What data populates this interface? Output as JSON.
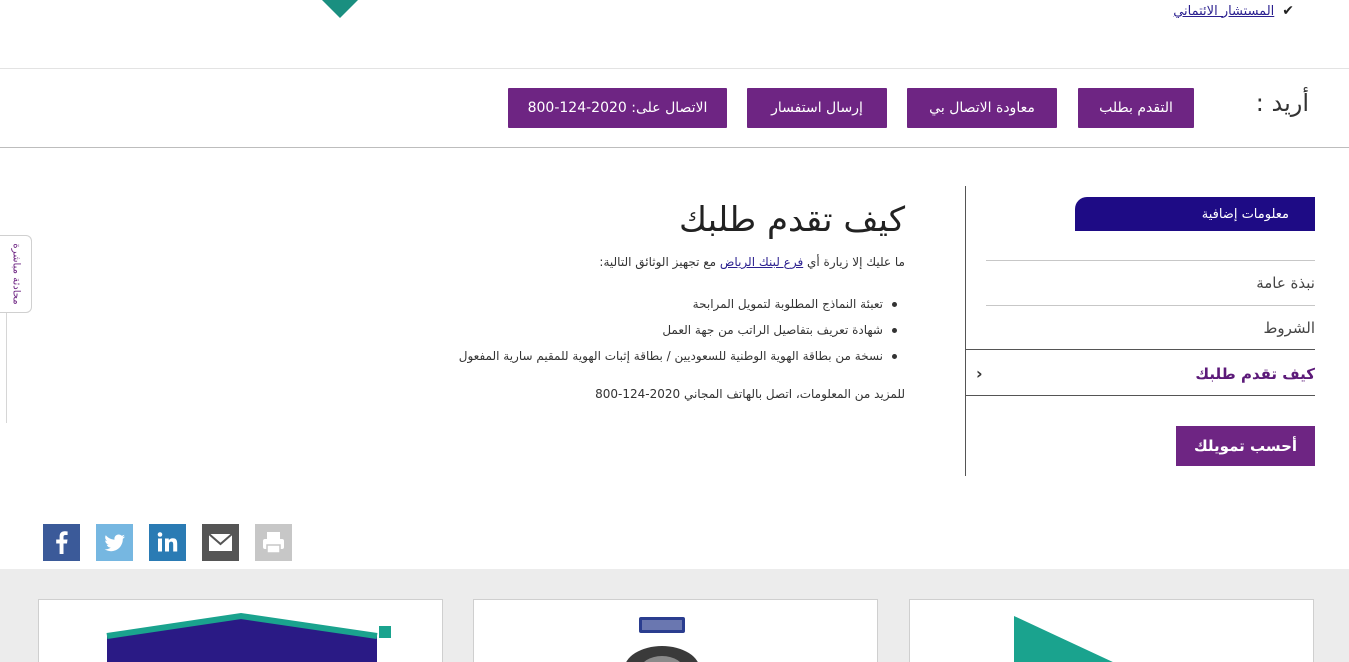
{
  "top": {
    "link_label": "المستشار الائتماني",
    "check_icon": "check-icon",
    "logo_icon": "brand-logo-icon"
  },
  "action_bar": {
    "want_label": "أريد :",
    "buttons": [
      {
        "label": "التقدم بطلب"
      },
      {
        "label": "معاودة الاتصال بي"
      },
      {
        "label": "إرسال استفسار"
      },
      {
        "label": "الاتصال على: 2020-124-800"
      }
    ]
  },
  "side_tab": {
    "label": "محادثة مباشرة"
  },
  "main": {
    "title": "كيف تقدم طلبك",
    "intro_before": "ما عليك إلا زيارة أي ",
    "intro_link": "فرع لبنك الرياض",
    "intro_after": " مع تجهيز الوثائق التالية:",
    "documents": [
      "تعبئة النماذج المطلوبة لتمويل المرابحة",
      "شهادة تعريف بتفاصيل الراتب من جهة العمل",
      "نسخة من بطاقة الهوية الوطنية للسعوديين / بطاقة إثبات الهوية للمقيم سارية المفعول"
    ],
    "more_info": "للمزيد من المعلومات، اتصل بالهاتف المجاني 2020-124-800"
  },
  "panel": {
    "header": "معلومات إضافية",
    "items": [
      {
        "label": "نبذة عامة"
      },
      {
        "label": "الشروط"
      }
    ],
    "active_item": "كيف تقدم طلبك",
    "calculator_button": "أحسب تمويلك"
  },
  "share": {
    "icons": [
      "facebook-icon",
      "twitter-icon",
      "linkedin-icon",
      "email-icon",
      "print-icon"
    ]
  },
  "colors": {
    "purple": "#6e2583",
    "navy": "#1e0b85",
    "teal": "#1aa38e",
    "facebook": "#3b5a99",
    "twitter": "#76b7e1",
    "linkedin": "#2a7bb4",
    "email": "#555555",
    "print": "#c7c7c7"
  }
}
